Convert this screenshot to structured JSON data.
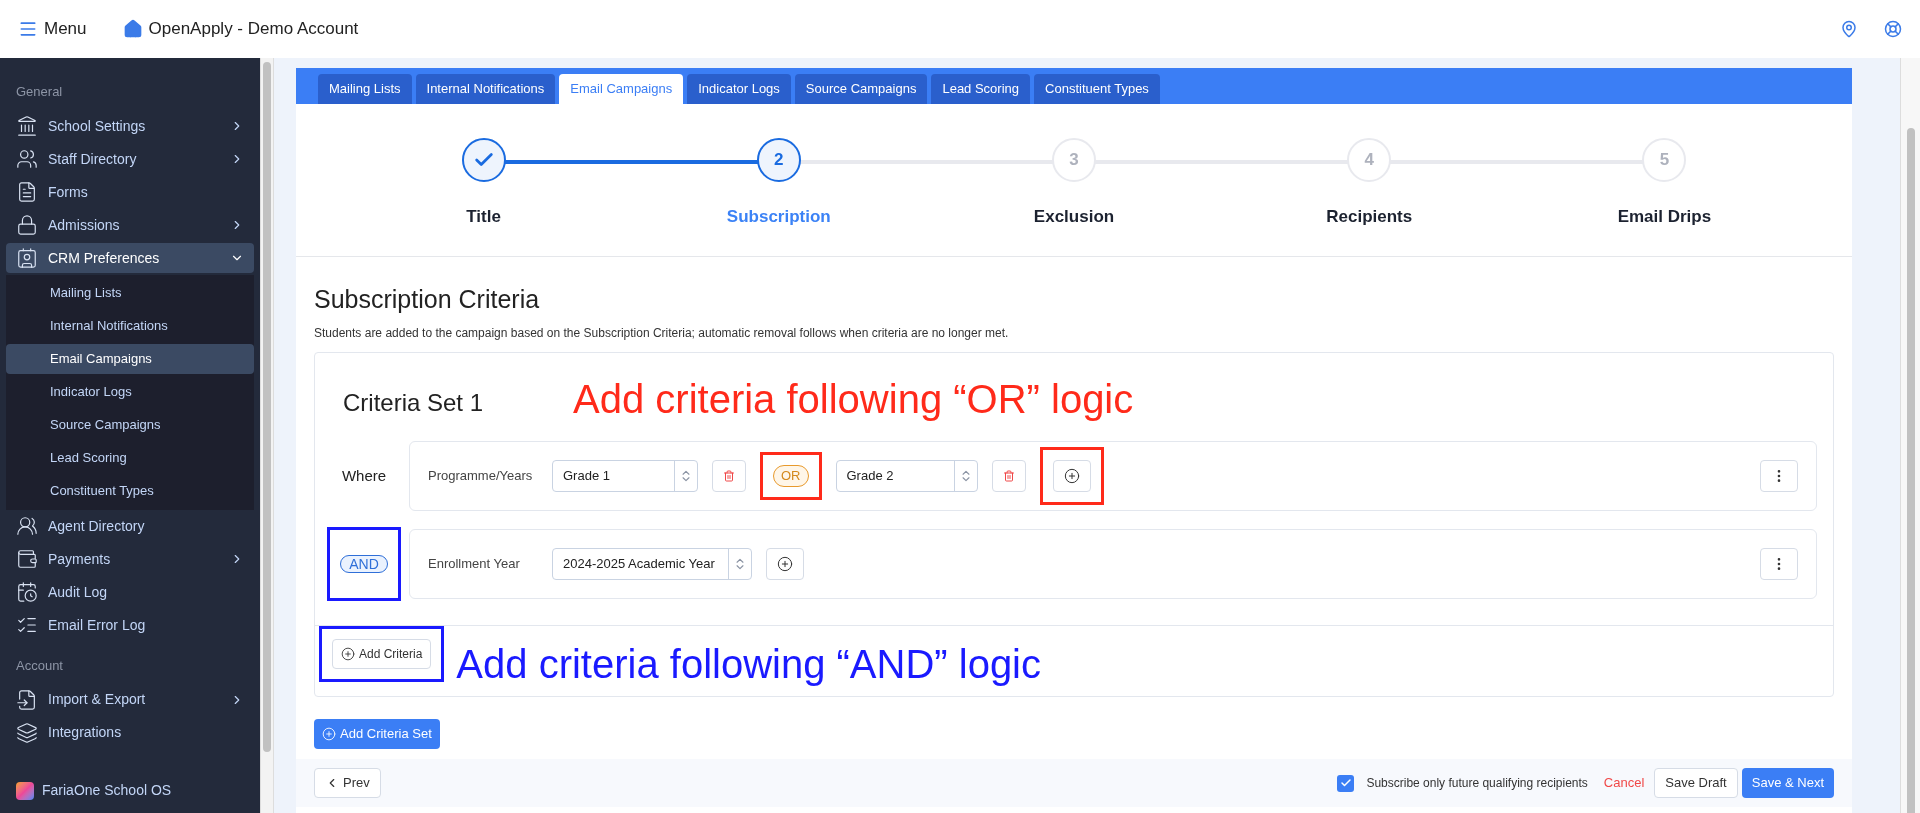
{
  "header": {
    "menu_label": "Menu",
    "title": "OpenApply - Demo Account"
  },
  "sidebar": {
    "sections": [
      {
        "heading": "General",
        "items": [
          {
            "label": "School Settings",
            "kind": "group",
            "expanded": false,
            "selected": false
          },
          {
            "label": "Staff Directory",
            "kind": "group",
            "expanded": false,
            "selected": false
          },
          {
            "label": "Forms",
            "kind": "link",
            "selected": false
          },
          {
            "label": "Admissions",
            "kind": "group",
            "expanded": false,
            "selected": false
          },
          {
            "label": "CRM Preferences",
            "kind": "group",
            "expanded": true,
            "selected": true,
            "children": [
              {
                "label": "Mailing Lists",
                "selected": false
              },
              {
                "label": "Internal Notifications",
                "selected": false
              },
              {
                "label": "Email Campaigns",
                "selected": true
              },
              {
                "label": "Indicator Logs",
                "selected": false
              },
              {
                "label": "Source Campaigns",
                "selected": false
              },
              {
                "label": "Lead Scoring",
                "selected": false
              },
              {
                "label": "Constituent Types",
                "selected": false
              }
            ]
          },
          {
            "label": "Agent Directory",
            "kind": "link",
            "selected": false
          },
          {
            "label": "Payments",
            "kind": "group",
            "expanded": false,
            "selected": false
          },
          {
            "label": "Audit Log",
            "kind": "link",
            "selected": false
          },
          {
            "label": "Email Error Log",
            "kind": "link",
            "selected": false
          }
        ]
      },
      {
        "heading": "Account",
        "items": [
          {
            "label": "Import & Export",
            "kind": "group",
            "expanded": false,
            "selected": false
          },
          {
            "label": "Integrations",
            "kind": "link",
            "selected": false
          }
        ]
      }
    ],
    "footer": "FariaOne School OS"
  },
  "tabs": [
    {
      "label": "Mailing Lists",
      "selected": false
    },
    {
      "label": "Internal Notifications",
      "selected": false
    },
    {
      "label": "Email Campaigns",
      "selected": true
    },
    {
      "label": "Indicator Logs",
      "selected": false
    },
    {
      "label": "Source Campaigns",
      "selected": false
    },
    {
      "label": "Lead Scoring",
      "selected": false
    },
    {
      "label": "Constituent Types",
      "selected": false
    }
  ],
  "steps": [
    {
      "label": "Title",
      "completed": true,
      "selected": false
    },
    {
      "number": "2",
      "label": "Subscription",
      "completed": false,
      "selected": true
    },
    {
      "number": "3",
      "label": "Exclusion",
      "completed": false,
      "selected": false
    },
    {
      "number": "4",
      "label": "Recipients",
      "completed": false,
      "selected": false
    },
    {
      "number": "5",
      "label": "Email Drips",
      "completed": false,
      "selected": false
    }
  ],
  "section": {
    "title": "Subscription Criteria",
    "description": "Students are added to the campaign based on the Subscription Criteria; automatic removal follows when criteria are no longer met."
  },
  "criteria_set": {
    "title": "Criteria Set 1",
    "rows": [
      {
        "connector": "Where",
        "kind": "text",
        "field": "Programme/Years",
        "annotated": true,
        "joiner": "OR",
        "options": [
          {
            "value": "Grade 1",
            "deletable": true
          },
          {
            "value": "Grade 2",
            "deletable": true
          }
        ]
      },
      {
        "connector": "AND",
        "kind": "badge",
        "field": "Enrollment Year",
        "annotated": true,
        "options": [
          {
            "value": "2024-2025 Academic Year",
            "deletable": false
          }
        ]
      }
    ],
    "add_criteria": {
      "label": "Add Criteria",
      "annotated": true
    }
  },
  "annotations": [
    {
      "text": "Add criteria following “OR” logic",
      "color": "#ff2a1a"
    },
    {
      "text": "Add criteria following “AND” logic",
      "color": "#1a1aff"
    }
  ],
  "add_criteria_set": "Add Criteria Set",
  "footer": {
    "prev": "Prev",
    "checkbox": {
      "label": "Subscribe only future qualifying recipients",
      "checked": true
    },
    "cancel": "Cancel",
    "save_draft": "Save Draft",
    "save_next": "Save & Next"
  }
}
